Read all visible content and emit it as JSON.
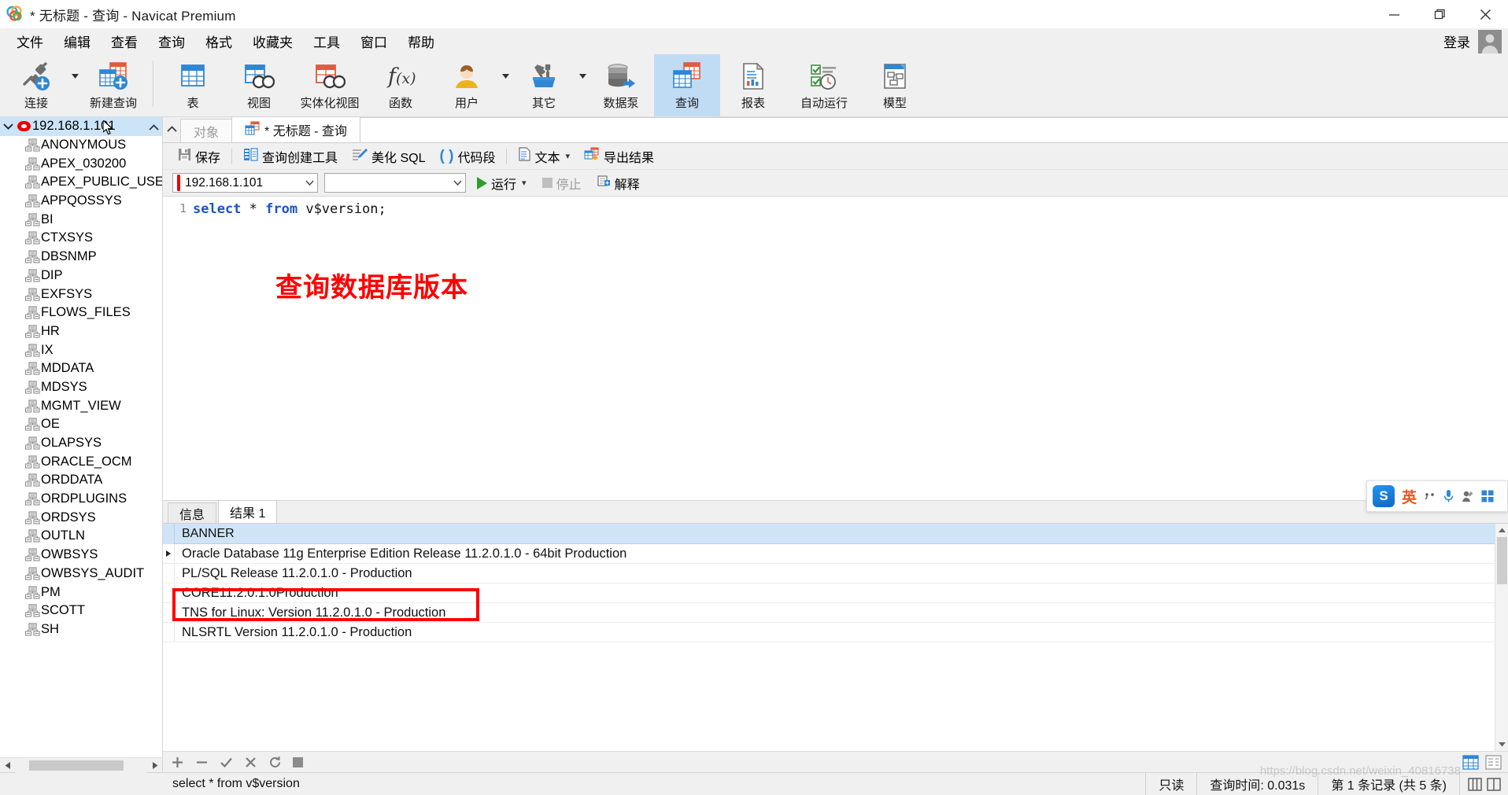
{
  "window": {
    "title": "* 无标题 - 查询 - Navicat Premium",
    "minimize_label": "minimize",
    "maximize_label": "restore",
    "close_label": "close"
  },
  "menubar": {
    "items": [
      {
        "label": "文件"
      },
      {
        "label": "编辑"
      },
      {
        "label": "查看"
      },
      {
        "label": "查询"
      },
      {
        "label": "格式"
      },
      {
        "label": "收藏夹"
      },
      {
        "label": "工具"
      },
      {
        "label": "窗口"
      },
      {
        "label": "帮助"
      }
    ],
    "login_label": "登录"
  },
  "ribbon": {
    "items": [
      {
        "label": "连接",
        "icon": "connection-icon",
        "caret": true,
        "active": false
      },
      {
        "label": "新建查询",
        "icon": "new-query-icon",
        "caret": false,
        "active": false
      },
      {
        "label": "表",
        "icon": "table-icon",
        "caret": false,
        "active": false
      },
      {
        "label": "视图",
        "icon": "view-icon",
        "caret": false,
        "active": false
      },
      {
        "label": "实体化视图",
        "icon": "materialized-view-icon",
        "caret": false,
        "active": false
      },
      {
        "label": "函数",
        "icon": "function-icon",
        "caret": false,
        "active": false
      },
      {
        "label": "用户",
        "icon": "user-icon",
        "caret": true,
        "active": false
      },
      {
        "label": "其它",
        "icon": "other-tools-icon",
        "caret": true,
        "active": false
      },
      {
        "label": "数据泵",
        "icon": "data-pump-icon",
        "caret": false,
        "active": false
      },
      {
        "label": "查询",
        "icon": "query-icon",
        "caret": false,
        "active": true
      },
      {
        "label": "报表",
        "icon": "report-icon",
        "caret": false,
        "active": false
      },
      {
        "label": "自动运行",
        "icon": "automation-icon",
        "caret": false,
        "active": false
      },
      {
        "label": "模型",
        "icon": "model-icon",
        "caret": false,
        "active": false
      }
    ]
  },
  "sidebar": {
    "connection": {
      "label": "192.168.1.101",
      "icon": "oracle-connection-icon",
      "expanded": true
    },
    "schemas": [
      "ANONYMOUS",
      "APEX_030200",
      "APEX_PUBLIC_USE",
      "APPQOSSYS",
      "BI",
      "CTXSYS",
      "DBSNMP",
      "DIP",
      "EXFSYS",
      "FLOWS_FILES",
      "HR",
      "IX",
      "MDDATA",
      "MDSYS",
      "MGMT_VIEW",
      "OE",
      "OLAPSYS",
      "ORACLE_OCM",
      "ORDDATA",
      "ORDPLUGINS",
      "ORDSYS",
      "OUTLN",
      "OWBSYS",
      "OWBSYS_AUDIT",
      "PM",
      "SCOTT",
      "SH"
    ]
  },
  "tabs": [
    {
      "label": "对象",
      "active": false,
      "icon": "objects-icon"
    },
    {
      "label": "* 无标题 - 查询",
      "active": true,
      "icon": "query-tab-icon"
    }
  ],
  "query_toolbar": {
    "items": [
      {
        "label": "保存",
        "icon": "save-icon",
        "caret": false
      },
      {
        "label": "查询创建工具",
        "icon": "query-builder-icon",
        "caret": false
      },
      {
        "label": "美化 SQL",
        "icon": "beautify-sql-icon",
        "caret": false
      },
      {
        "label": "代码段",
        "icon": "snippet-icon",
        "caret": false
      },
      {
        "label": "文本",
        "icon": "text-icon",
        "caret": true
      },
      {
        "label": "导出结果",
        "icon": "export-result-icon",
        "caret": false
      }
    ]
  },
  "connection_bar": {
    "connection_value": "192.168.1.101",
    "database_value": "",
    "run_label": "运行",
    "stop_label": "停止",
    "explain_label": "解释"
  },
  "editor": {
    "line_number": "1",
    "code": {
      "kw_select": "select",
      "star": " * ",
      "kw_from": "from",
      "table": " v$version;"
    },
    "annotation": "查询数据库版本",
    "annotation_color": "#ff0000"
  },
  "results": {
    "tabs": [
      {
        "label": "信息",
        "active": false
      },
      {
        "label": "结果 1",
        "active": true
      }
    ],
    "columns": [
      "BANNER"
    ],
    "rows": [
      {
        "value": "Oracle Database 11g Enterprise Edition Release 11.2.0.1.0 - 64bit Production",
        "current": true,
        "highlighted": false
      },
      {
        "value": "PL/SQL Release 11.2.0.1.0 - Production",
        "current": false,
        "highlighted": false
      },
      {
        "value": "CORE\t11.2.0.1.0\tProduction",
        "current": false,
        "highlighted": true
      },
      {
        "value": "TNS for Linux: Version 11.2.0.1.0 - Production",
        "current": false,
        "highlighted": false
      },
      {
        "value": "NLSRTL Version 11.2.0.1.0 - Production",
        "current": false,
        "highlighted": false
      }
    ],
    "footer_icons": [
      "add-record-icon",
      "remove-record-icon",
      "confirm-edit-icon",
      "cancel-edit-icon",
      "refresh-icon",
      "stop-icon"
    ],
    "view_mode_icons": [
      "grid-view-icon",
      "form-view-icon"
    ]
  },
  "statusbar": {
    "sql": "select * from v$version",
    "readonly": "只读",
    "query_time": "查询时间: 0.031s",
    "record_info": "第 1 条记录 (共 5 条)"
  },
  "ime": {
    "logo_text": "S",
    "mode_label": "英",
    "icons": [
      "punctuation-icon",
      "microphone-icon",
      "handwriting-icon",
      "toolbox-icon"
    ]
  },
  "watermark": "https://blog.csdn.net/weixin_40816738"
}
